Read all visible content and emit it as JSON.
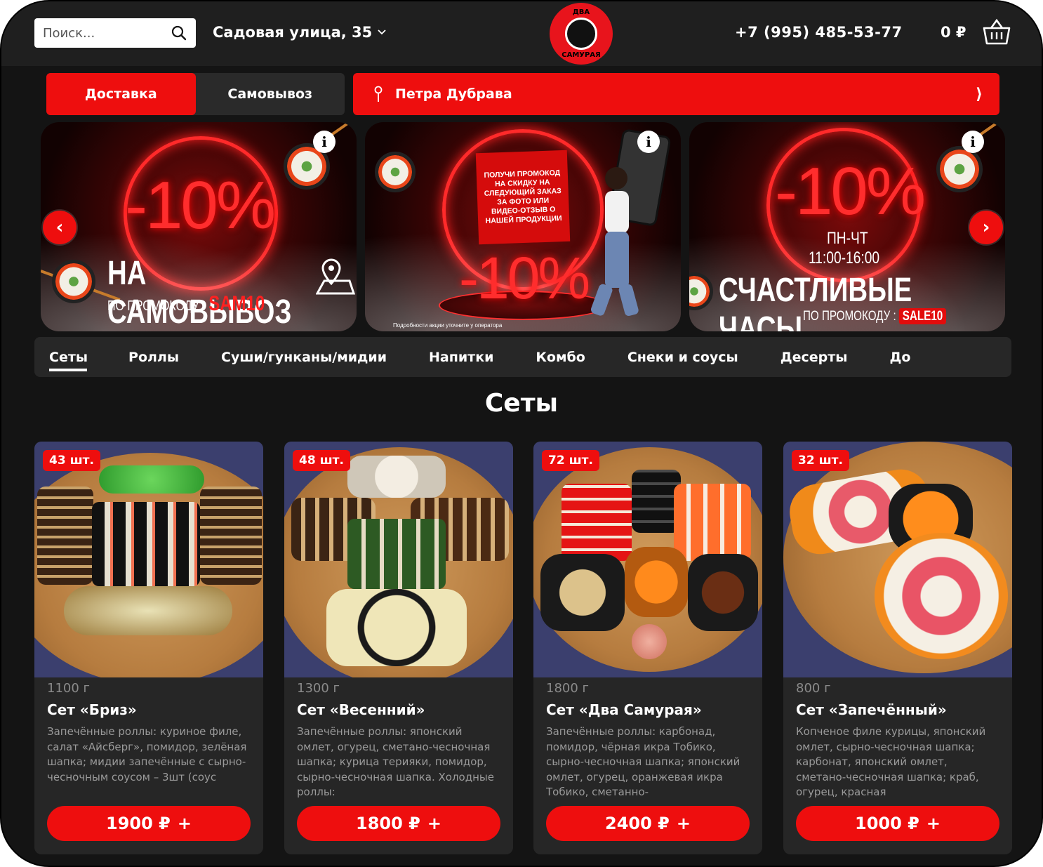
{
  "header": {
    "search_placeholder": "Поиск...",
    "address": "Садовая улица, 35",
    "logo_text_top": "ДВА",
    "logo_text_bottom": "САМУРАЯ",
    "phone": "+7 (995) 485-53-77",
    "cart_total": "0 ₽"
  },
  "delivery": {
    "modes": [
      "Доставка",
      "Самовывоз"
    ],
    "active_mode": "Доставка",
    "location": "Петра Дубрава"
  },
  "banners": [
    {
      "percent": "-10%",
      "title": "НА САМОВЫВОЗ",
      "promo_label": "ПО ПРОМОКОДУ :",
      "promo_code": "SAM10"
    },
    {
      "percent": "-10%",
      "note": "ПОЛУЧИ ПРОМОКОД НА СКИДКУ НА СЛЕДУЮЩИЙ ЗАКАЗ ЗА ФОТО ИЛИ ВИДЕО-ОТЗЫВ О НАШЕЙ ПРОДУКЦИИ",
      "fine_print": "Подробности акции уточните у оператора"
    },
    {
      "percent": "-10%",
      "days": "ПН-ЧТ",
      "hours": "11:00-16:00",
      "title": "СЧАСТЛИВЫЕ ЧАСЫ",
      "promo_label": "ПО ПРОМОКОДУ :",
      "promo_code": "SALE10"
    }
  ],
  "categories": [
    "Сеты",
    "Роллы",
    "Суши/гунканы/мидии",
    "Напитки",
    "Комбо",
    "Снеки и соусы",
    "Десерты",
    "До"
  ],
  "active_category": "Сеты",
  "section_title": "Сеты",
  "products": [
    {
      "badge": "43 шт.",
      "weight": "1100 г",
      "name": "Сет «Бриз»",
      "description": "Запечённые роллы: куриное филе, салат «Айсберг», помидор, зелёная шапка; мидии запечённые с сырно-чесночным соусом – 3шт (соус",
      "price": "1900 ₽",
      "add": "+"
    },
    {
      "badge": "48 шт.",
      "weight": "1300 г",
      "name": "Сет «Весенний»",
      "description": "Запечённые роллы: японский омлет, огурец, сметано-чесночная шапка; курица терияки, помидор, сырно-чесночная шапка. Холодные роллы:",
      "price": "1800 ₽",
      "add": "+"
    },
    {
      "badge": "72 шт.",
      "weight": "1800 г",
      "name": "Сет «Два Самурая»",
      "description": "Запечённые роллы: карбонад, помидор, чёрная икра Тобико, сырно-чесночная шапка; японский омлет, огурец, оранжевая икра Тобико, сметанно-",
      "price": "2400 ₽",
      "add": "+"
    },
    {
      "badge": "32 шт.",
      "weight": "800 г",
      "name": "Сет «Запечённый»",
      "description": "Копченое филе курицы, японский омлет, сырно-чесночная шапка; карбонат, японский омлет, сметано-чесночная шапка; краб, огурец, красная",
      "price": "1000 ₽",
      "add": "+"
    }
  ],
  "colors": {
    "accent": "#ee0e0e",
    "background": "#141414",
    "header": "#1f1f1f",
    "card": "#262626"
  }
}
